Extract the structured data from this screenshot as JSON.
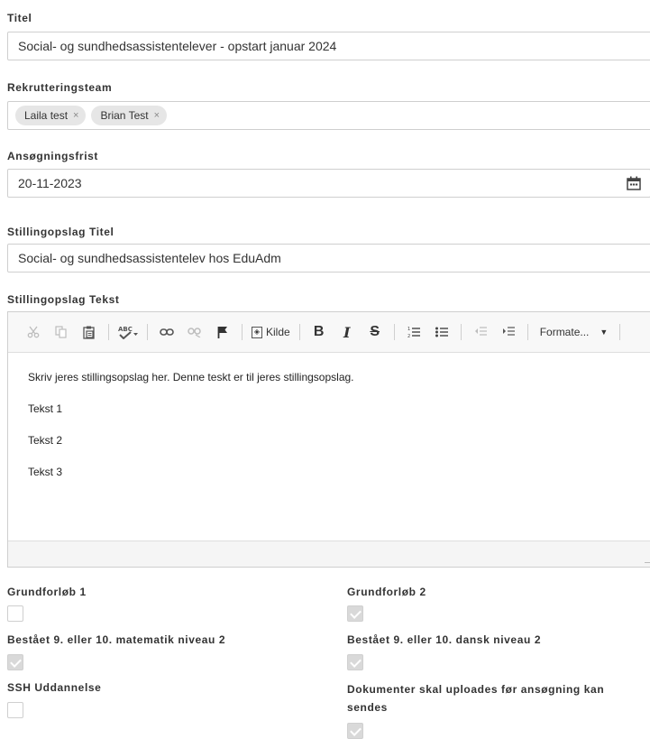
{
  "titel": {
    "label": "Titel",
    "value": "Social- og sundhedsassistentelever - opstart januar 2024"
  },
  "rekruttering": {
    "label": "Rekrutteringsteam",
    "tags": [
      {
        "name": "Laila test",
        "remove": "×"
      },
      {
        "name": "Brian Test",
        "remove": "×"
      }
    ]
  },
  "frist": {
    "label": "Ansøgningsfrist",
    "value": "20-11-2023"
  },
  "opslag_titel": {
    "label": "Stillingopslag Titel",
    "value": "Social- og sundhedsassistentelev hos EduAdm"
  },
  "opslag_tekst": {
    "label": "Stillingopslag Tekst",
    "toolbar": {
      "source_label": "Kilde",
      "format_label": "Formate...",
      "bold": "B",
      "italic": "I",
      "strike": "S"
    },
    "paragraphs": [
      "Skriv jeres stillingsopslag her. Denne teskt er til jeres stillingsopslag.",
      "Tekst 1",
      "Tekst 2",
      "Tekst 3"
    ]
  },
  "checkboxes": {
    "grundforloeb1": {
      "label": "Grundforløb 1",
      "checked": false
    },
    "grundforloeb2": {
      "label": "Grundforløb 2",
      "checked": true
    },
    "matematik": {
      "label": "Bestået 9. eller 10. matematik niveau 2",
      "checked": true
    },
    "dansk": {
      "label": "Bestået 9. eller 10. dansk niveau 2",
      "checked": true
    },
    "ssh": {
      "label": "SSH Uddannelse",
      "checked": false
    },
    "dokumenter": {
      "label_line1": "Dokumenter skal uploades før ansøgning kan",
      "label_line2": "sendes",
      "checked": true
    }
  }
}
